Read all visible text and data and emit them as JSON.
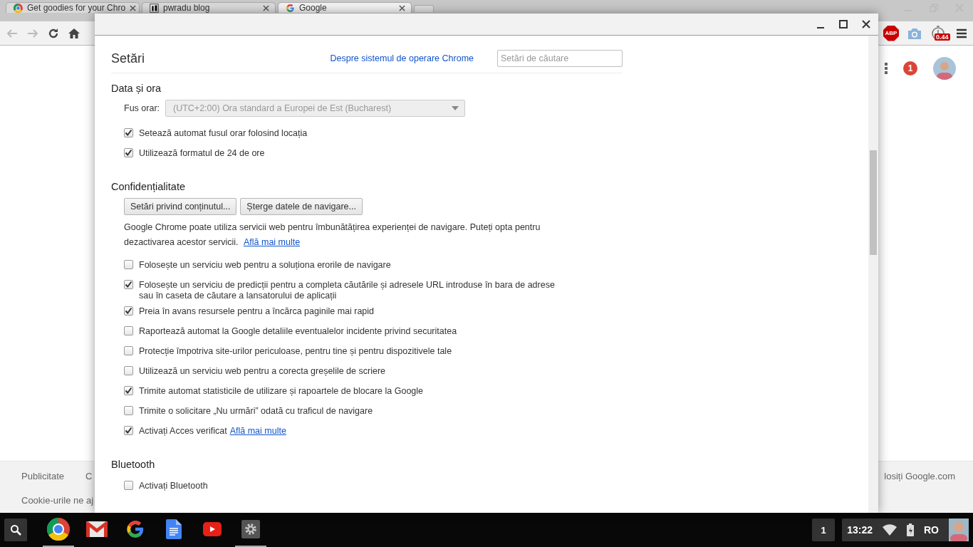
{
  "browser": {
    "tabs": [
      {
        "title": "Get goodies for your Chro",
        "selected": false
      },
      {
        "title": "pwradu blog",
        "selected": false
      },
      {
        "title": "Google",
        "selected": true
      }
    ],
    "adblock_label": "ABP",
    "extension_badge": "0.44",
    "page": {
      "notification_count": "1",
      "footer_links": [
        "Publicitate",
        "C"
      ],
      "footer_text": "Cookie-urile ne aj",
      "footer_right": "losiți Google.com"
    }
  },
  "settings": {
    "title": "Setări",
    "about_link": "Despre sistemul de operare Chrome",
    "search": {
      "placeholder": "Setări de căutare"
    },
    "sections": [
      {
        "title": "Data și ora",
        "items": [
          {
            "kind": "select",
            "label": "Fus orar:",
            "value": "(UTC+2:00) Ora standard a Europei de Est (Bucharest)",
            "disabled": true
          },
          {
            "kind": "checkbox",
            "label": "Setează automat fusul orar folosind locația",
            "checked": true
          },
          {
            "kind": "checkbox",
            "label": "Utilizează formatul de 24 de ore",
            "checked": true
          }
        ]
      },
      {
        "title": "Confidențialitate",
        "items": [
          {
            "kind": "buttons",
            "labels": [
              "Setări privind conținutul...",
              "Șterge datele de navigare..."
            ]
          },
          {
            "kind": "paragraph",
            "text": "Google Chrome poate utiliza servicii web pentru îmbunătățirea experienței de navigare. Puteți opta pentru dezactivarea acestor servicii.",
            "link": "Află mai multe"
          },
          {
            "kind": "checkbox",
            "label": "Folosește un serviciu web pentru a soluționa erorile de navigare",
            "checked": false
          },
          {
            "kind": "checkbox",
            "label": "Folosește un serviciu de predicții pentru a completa căutările și adresele URL introduse în bara de adrese sau în caseta de căutare a lansatorului de aplicații",
            "checked": true
          },
          {
            "kind": "checkbox",
            "label": "Preia în avans resursele pentru a încărca paginile mai rapid",
            "checked": true
          },
          {
            "kind": "checkbox",
            "label": "Raportează automat la Google detaliile eventualelor incidente privind securitatea",
            "checked": false
          },
          {
            "kind": "checkbox",
            "label": "Protecție împotriva site-urilor periculoase, pentru tine și pentru dispozitivele tale",
            "checked": false
          },
          {
            "kind": "checkbox",
            "label": "Utilizează un serviciu web pentru a corecta greșelile de scriere",
            "checked": false
          },
          {
            "kind": "checkbox",
            "label": "Trimite automat statisticile de utilizare și rapoartele de blocare la Google",
            "checked": true
          },
          {
            "kind": "checkbox",
            "label": "Trimite o solicitare „Nu urmări” odată cu traficul de navigare",
            "checked": false
          },
          {
            "kind": "checkbox",
            "label": "Activați Acces verificat",
            "checked": true,
            "link": "Află mai multe"
          }
        ]
      },
      {
        "title": "Bluetooth",
        "items": [
          {
            "kind": "checkbox",
            "label": "Activați Bluetooth",
            "checked": false
          }
        ]
      }
    ]
  },
  "taskbar": {
    "apps": [
      {
        "running": true
      },
      {
        "running": false
      },
      {
        "running": false
      },
      {
        "running": false
      },
      {
        "running": false
      },
      {
        "running": true
      }
    ],
    "notification_count": "1",
    "time": "13:22",
    "input_method": "RO"
  }
}
